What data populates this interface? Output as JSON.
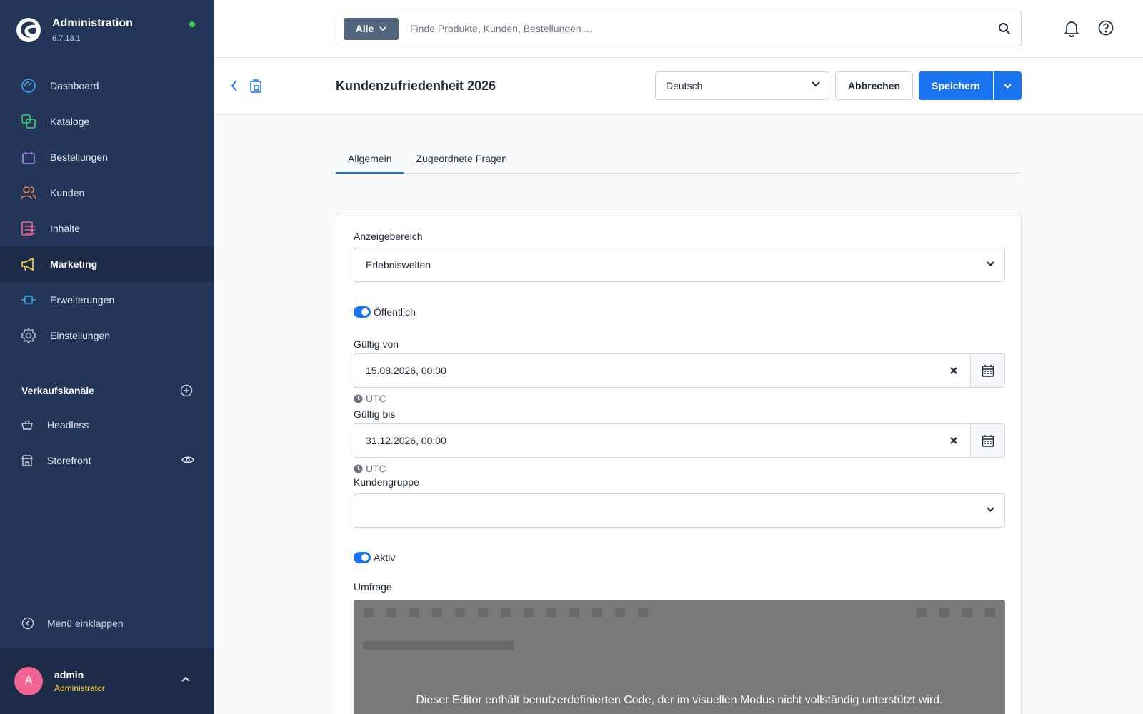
{
  "app": {
    "title": "Administration",
    "version": "6.7.13.1"
  },
  "nav": [
    {
      "label": "Dashboard",
      "icon": "dashboard-icon",
      "color": "#3ba7e5"
    },
    {
      "label": "Kataloge",
      "icon": "catalog-icon",
      "color": "#37d076"
    },
    {
      "label": "Bestellungen",
      "icon": "bag-icon",
      "color": "#a992f0"
    },
    {
      "label": "Kunden",
      "icon": "users-icon",
      "color": "#f0895a"
    },
    {
      "label": "Inhalte",
      "icon": "content-icon",
      "color": "#f06593"
    },
    {
      "label": "Marketing",
      "icon": "megaphone-icon",
      "color": "#ffd43b"
    },
    {
      "label": "Erweiterungen",
      "icon": "plugin-icon",
      "color": "#2ba9ec"
    },
    {
      "label": "Einstellungen",
      "icon": "gear-icon",
      "color": "#a3adbb"
    }
  ],
  "sales_channels": {
    "label": "Verkaufskanäle",
    "items": [
      {
        "label": "Headless"
      },
      {
        "label": "Storefront"
      }
    ]
  },
  "collapse_label": "Menü einklappen",
  "user": {
    "initial": "A",
    "name": "admin",
    "role": "Administrator"
  },
  "search": {
    "filter": "Alle",
    "placeholder": "Finde Produkte, Kunden, Bestellungen ..."
  },
  "page": {
    "title": "Kundenzufriedenheit 2026",
    "language": "Deutsch",
    "cancel": "Abbrechen",
    "save": "Speichern"
  },
  "tabs": [
    {
      "label": "Allgemein"
    },
    {
      "label": "Zugeordnete Fragen"
    }
  ],
  "form": {
    "display_area_label": "Anzeigebereich",
    "display_area_value": "Erlebniswelten",
    "public_label": "Öffentlich",
    "valid_from_label": "Gültig von",
    "valid_from_value": "15.08.2026, 00:00",
    "valid_to_label": "Gültig bis",
    "valid_to_value": "31.12.2026, 00:00",
    "timezone": "UTC",
    "customer_group_label": "Kundengruppe",
    "customer_group_value": "",
    "active_label": "Aktiv",
    "survey_label": "Umfrage",
    "editor_notice": "Dieser Editor enthält benutzerdefinierten Code, der im visuellen Modus nicht vollständig unterstützt wird."
  },
  "colors": {
    "sidebar": "#233659",
    "primary": "#1a74f0",
    "avatar": "#f06593",
    "online": "#37d046"
  }
}
